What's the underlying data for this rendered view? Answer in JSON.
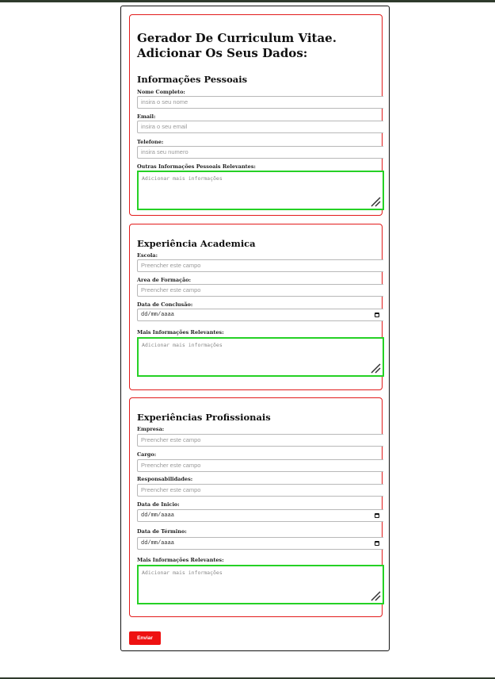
{
  "header": {
    "title_line1": "Gerador De Curriculum Vitae.",
    "title_line2": "Adicionar Os Seus Dados:"
  },
  "personal": {
    "heading": "Informações Pessoais",
    "name_label": "Nome Completo:",
    "name_placeholder": "insira o seu nome",
    "email_label": "Email:",
    "email_placeholder": "insira o seu email",
    "phone_label": "Telefone:",
    "phone_placeholder": "insira seu numero",
    "other_label": "Outras Informações Pessoais Relevantes:",
    "other_placeholder": "Adicionar mais informações"
  },
  "academic": {
    "heading": "Experiência Academica",
    "school_label": "Escola:",
    "school_placeholder": "Preencher este campo",
    "area_label": "Area de Formação:",
    "area_placeholder": "Preencher este campo",
    "date_label": "Data de Conclusão:",
    "date_placeholder": "dd/mm/aaaa",
    "more_label": "Mais Informações Relevantes:",
    "more_placeholder": "Adicionar mais informações"
  },
  "professional": {
    "heading": "Experiências Profissionais",
    "company_label": "Empresa:",
    "company_placeholder": "Preencher este campo",
    "role_label": "Cargo:",
    "role_placeholder": "Preencher este campo",
    "resp_label": "Responsabilidades:",
    "resp_placeholder": "Preencher este campo",
    "start_label": "Data de Inicio:",
    "start_placeholder": "dd/mm/aaaa",
    "end_label": "Data de Término:",
    "end_placeholder": "dd/mm/aaaa",
    "more_label": "Mais Informações Relevantes:",
    "more_placeholder": "Adicionar mais informações"
  },
  "submit_label": "Enviar",
  "colors": {
    "section_border": "#e21b1b",
    "textarea_border": "#25d125",
    "button_bg": "#ee1111",
    "topbar": "#2f3a2c"
  },
  "icons": {
    "date_picker": "calendar-icon",
    "textarea_resize": "resize-grip-icon"
  }
}
